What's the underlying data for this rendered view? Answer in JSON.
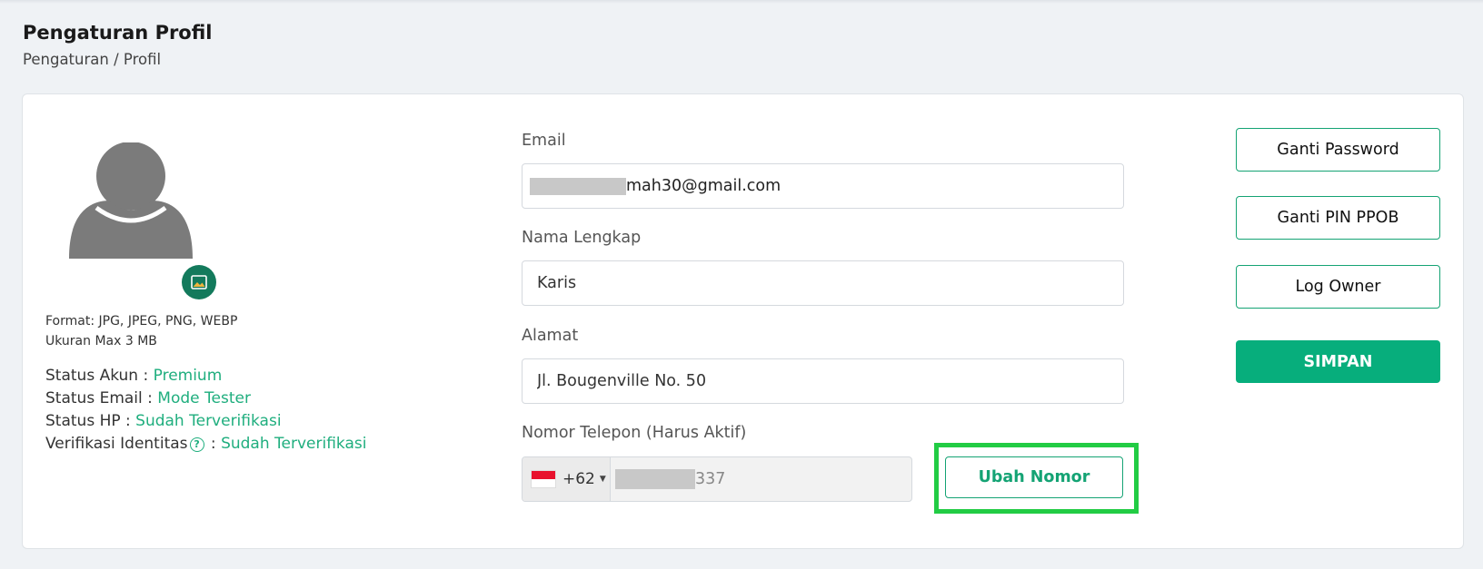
{
  "header": {
    "title": "Pengaturan Profil",
    "breadcrumb": [
      "Pengaturan",
      "/",
      "Profil"
    ]
  },
  "profile": {
    "format_text": "Format: JPG, JPEG, PNG, WEBP",
    "size_text": "Ukuran Max 3 MB",
    "statuses": [
      {
        "label": "Status Akun : ",
        "value": "Premium"
      },
      {
        "label": "Status Email : ",
        "value": "Mode Tester"
      },
      {
        "label": "Status HP : ",
        "value": "Sudah Terverifikasi"
      },
      {
        "label": "Verifikasi Identitas",
        "value": "Sudah Terverifikasi"
      }
    ],
    "verification_separator": " : "
  },
  "form": {
    "email_label": "Email",
    "email_value_visible": "mah30@gmail.com",
    "name_label": "Nama Lengkap",
    "name_value": "Karis",
    "address_label": "Alamat",
    "address_value": "Jl. Bougenville No. 50",
    "phone_label": "Nomor Telepon (Harus Aktif)",
    "phone_country_code": "+62",
    "phone_value_visible": "337"
  },
  "actions": {
    "change_number": "Ubah Nomor",
    "change_password": "Ganti Password",
    "change_pin": "Ganti PIN PPOB",
    "log_owner": "Log Owner",
    "save": "SIMPAN"
  },
  "colors": {
    "accent": "#14a374",
    "save_button": "#07ae7c",
    "status_value": "#1fae7e",
    "highlight_box": "#22cc44"
  }
}
